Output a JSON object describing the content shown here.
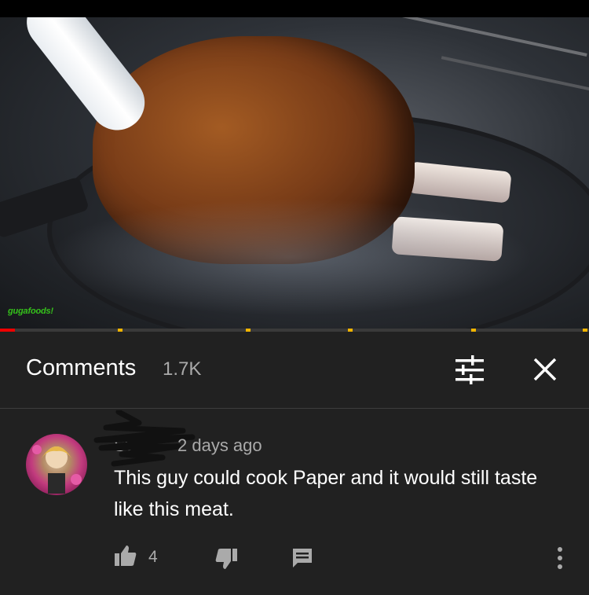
{
  "video": {
    "watermark": "gugafoods!"
  },
  "progress": {
    "played_fraction": 0.025
  },
  "comments_panel": {
    "title": "Comments",
    "count": "1.7K",
    "filter_icon": "sort-filter-icon",
    "close_icon": "close-icon"
  },
  "comment": {
    "author": "Sven",
    "time": "2 days ago",
    "text": "This guy could cook Paper and it would still taste like this meat.",
    "likes": "4",
    "like_icon": "thumbs-up-icon",
    "dislike_icon": "thumbs-down-icon",
    "reply_icon": "reply-icon",
    "more_icon": "more-vertical-icon"
  },
  "colors": {
    "background": "#212121",
    "secondary_text": "#aaaaaa",
    "progress_played": "#ee0000",
    "chapter_marker": "#f1b400"
  }
}
